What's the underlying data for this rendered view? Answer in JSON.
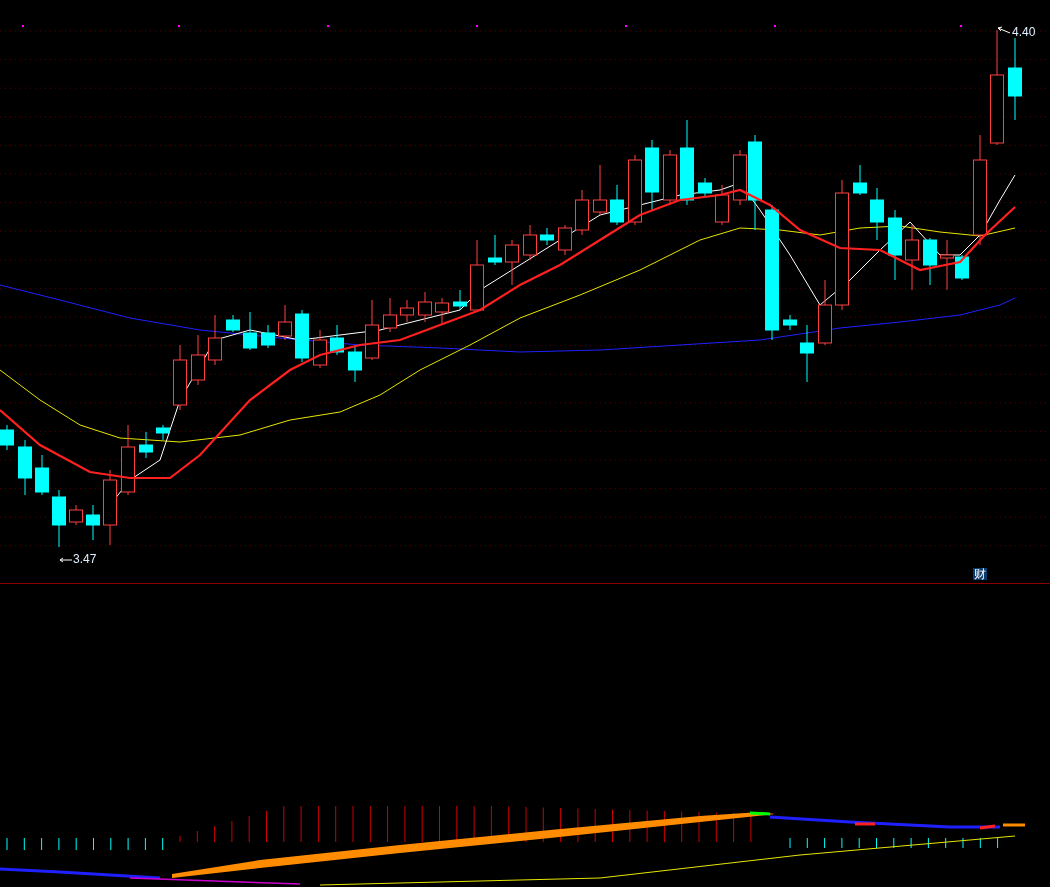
{
  "price_chart": {
    "high_label": "4.40",
    "low_label": "3.47",
    "badge": "财"
  }
}
